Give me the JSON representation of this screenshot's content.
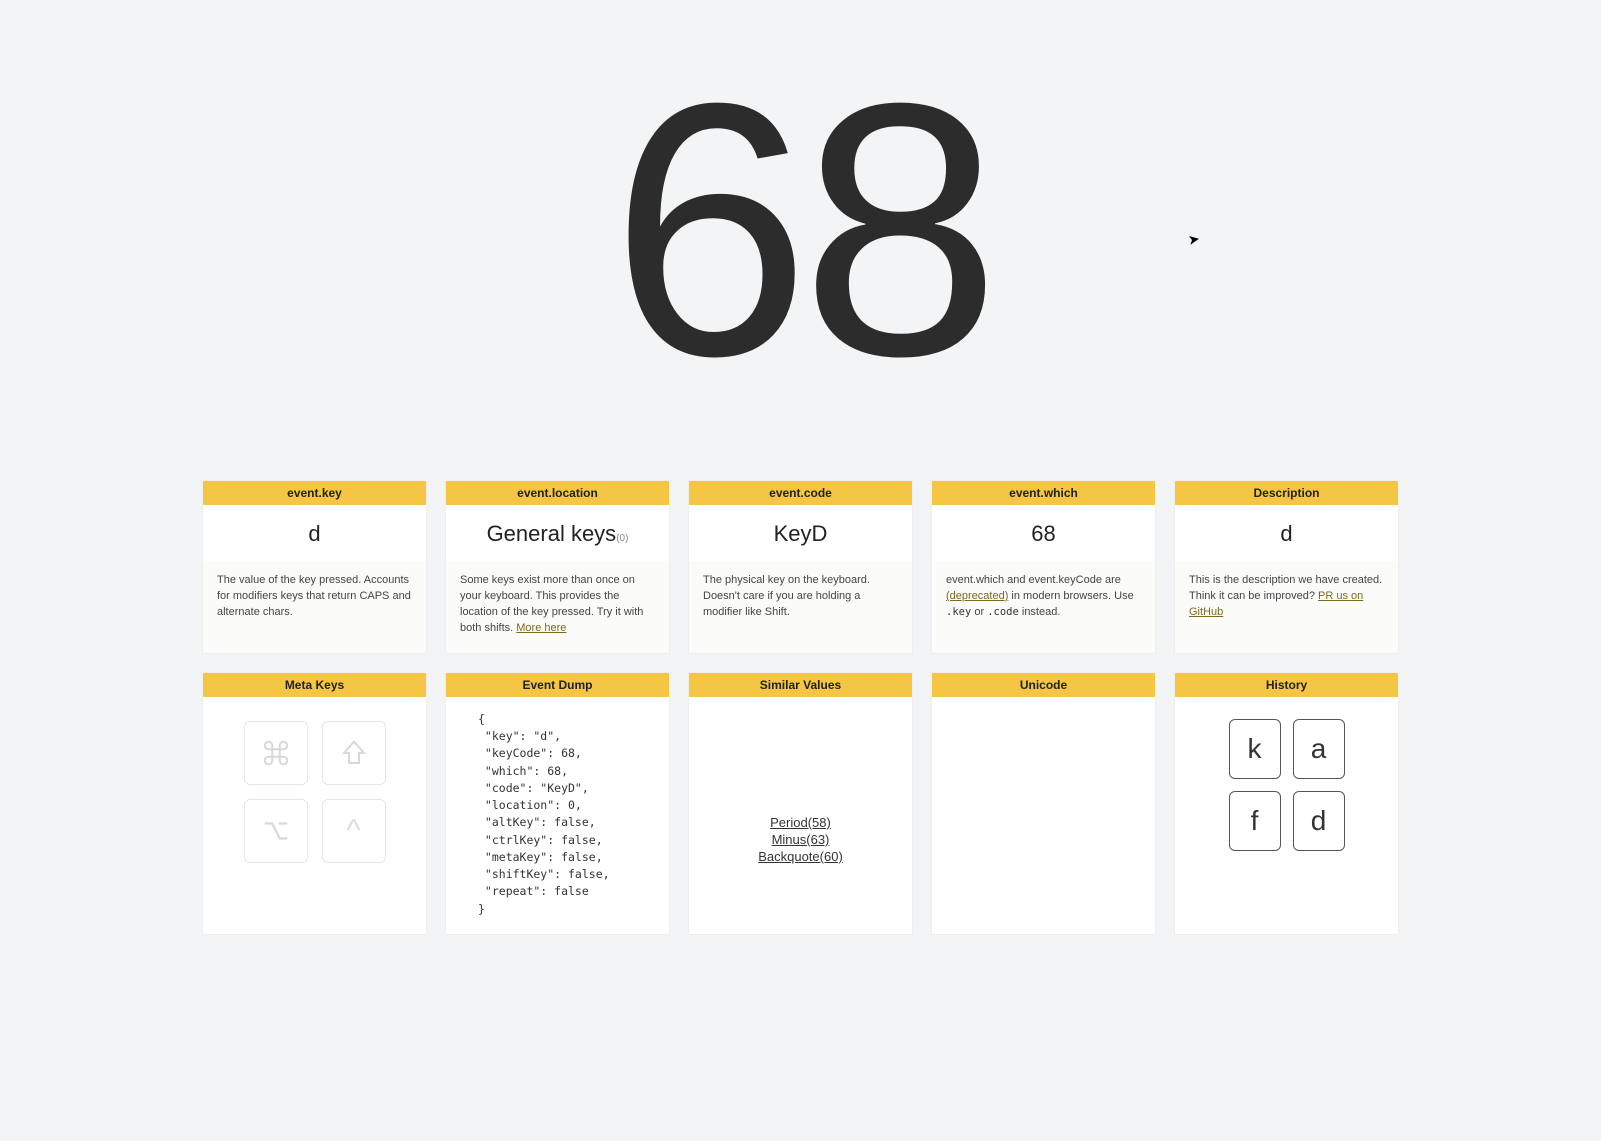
{
  "hero": {
    "value": "68"
  },
  "cards_row1": {
    "event_key": {
      "header": "event.key",
      "value": "d",
      "desc": "The value of the key pressed. Accounts for modifiers keys that return CAPS and alternate chars."
    },
    "event_location": {
      "header": "event.location",
      "value_main": "General keys",
      "value_sub": "(0)",
      "desc_pre": "Some keys exist more than once on your keyboard. This provides the location of the key pressed. Try it with both shifts. ",
      "more_link": "More here"
    },
    "event_code": {
      "header": "event.code",
      "value": "KeyD",
      "desc": "The physical key on the keyboard. Doesn't care if you are holding a modifier like Shift."
    },
    "event_which": {
      "header": "event.which",
      "value": "68",
      "desc_pre": "event.which and event.keyCode are ",
      "deprecated": "(deprecated)",
      "desc_mid": " in modern browsers. Use ",
      "code1": ".key",
      "or": " or ",
      "code2": ".code",
      "desc_post": " instead."
    },
    "description": {
      "header": "Description",
      "value": "d",
      "desc_pre": "This is the description we have created. Think it can be improved? ",
      "link": "PR us on GitHub"
    }
  },
  "cards_row2": {
    "meta_keys": {
      "header": "Meta Keys",
      "keys": {
        "cmd": "command-icon",
        "shift": "shift-icon",
        "option": "option-icon",
        "ctrl": "control-icon"
      }
    },
    "event_dump": {
      "header": "Event Dump",
      "dump_text": "{\n \"key\": \"d\",\n \"keyCode\": 68,\n \"which\": 68,\n \"code\": \"KeyD\",\n \"location\": 0,\n \"altKey\": false,\n \"ctrlKey\": false,\n \"metaKey\": false,\n \"shiftKey\": false,\n \"repeat\": false\n}",
      "dump": {
        "key": "d",
        "keyCode": 68,
        "which": 68,
        "code": "KeyD",
        "location": 0,
        "altKey": false,
        "ctrlKey": false,
        "metaKey": false,
        "shiftKey": false,
        "repeat": false
      }
    },
    "similar": {
      "header": "Similar Values",
      "items": [
        {
          "label": "Period(58)"
        },
        {
          "label": "Minus(63)"
        },
        {
          "label": "Backquote(60)"
        }
      ]
    },
    "unicode": {
      "header": "Unicode"
    },
    "history": {
      "header": "History",
      "items": [
        "k",
        "a",
        "f",
        "d"
      ]
    }
  }
}
